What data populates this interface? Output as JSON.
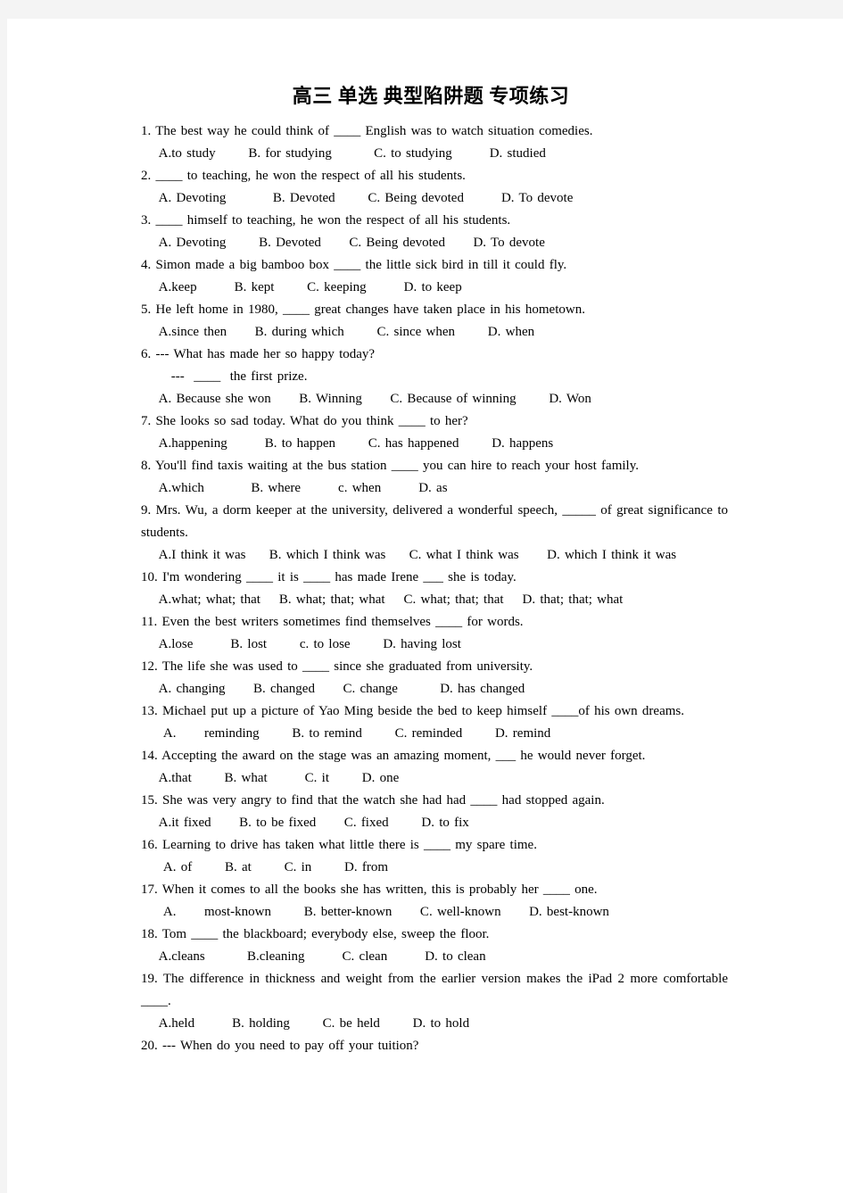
{
  "document": {
    "title": "高三 单选 典型陷阱题 专项练习"
  },
  "questions": [
    {
      "stem": "1. The best way he could think of ____ English was to watch situation comedies.",
      "options": "  A.to study       B. for studying         C. to studying        D. studied"
    },
    {
      "stem": "2. ____ to teaching, he won the respect of all his students.",
      "options": "  A. Devoting          B. Devoted       C. Being devoted        D. To devote"
    },
    {
      "stem": "3. ____ himself to teaching, he won the respect of all his students.",
      "options": "  A. Devoting       B. Devoted      C. Being devoted      D. To devote"
    },
    {
      "stem": "4. Simon made a big bamboo box ____ the little sick bird in till it could fly.",
      "options": "  A.keep        B. kept       C. keeping        D. to keep"
    },
    {
      "stem": "5. He left home in 1980, ____ great changes have taken place in his hometown.",
      "options": "  A.since then      B. during which       C. since when       D. when"
    },
    {
      "stem": "6. --- What has made her so happy today?",
      "dialog": "   ---  ____  the first prize.",
      "options": "  A. Because she won      B. Winning      C. Because of winning       D. Won"
    },
    {
      "stem": "7. She looks so sad today. What do you think ____ to her?",
      "options": "  A.happening        B. to happen       C. has happened       D. happens"
    },
    {
      "stem": "8. You'll find taxis waiting at the bus station ____ you can hire to reach your host family.",
      "options": "  A.which          B. where        c. when        D. as"
    },
    {
      "stem": "9. Mrs. Wu, a dorm keeper at the university, delivered a wonderful speech, _____ of great significance to students.",
      "options": "  A.I think it was     B. which I think was     C. what I think was      D. which I think it was"
    },
    {
      "stem": "10. I'm wondering ____ it is ____ has made Irene ___ she is today.",
      "options": "  A.what; what; that    B. what; that; what    C. what; that; that    D. that; that; what"
    },
    {
      "stem": "11. Even the best writers sometimes find themselves ____ for words.",
      "options": "  A.lose        B. lost       c. to lose       D. having lost"
    },
    {
      "stem": "12. The life she was used to ____ since she graduated from university.",
      "options": "  A. changing      B. changed      C. change         D. has changed"
    },
    {
      "stem": "13. Michael put up a picture of Yao Ming beside the bed to keep himself ____of his own dreams.",
      "options": "   A.      reminding       B. to remind       C. reminded       D. remind"
    },
    {
      "stem": "14. Accepting the award on the stage was an amazing moment, ___ he would never forget.",
      "options": "  A.that       B. what        C. it       D. one"
    },
    {
      "stem": "15. She was very angry to find that the watch she had had ____ had stopped again.",
      "options": "  A.it fixed      B. to be fixed      C. fixed       D. to fix"
    },
    {
      "stem": "16. Learning to drive has taken what little there is ____ my spare time.",
      "options": "   A. of       B. at       C. in       D. from"
    },
    {
      "stem": "17. When it comes to all the books she has written, this is probably her ____ one.",
      "options": "   A.      most-known       B. better-known      C. well-known      D. best-known"
    },
    {
      "stem": "18. Tom ____ the blackboard; everybody else, sweep the floor.",
      "options": "  A.cleans         B.cleaning        C. clean        D. to clean"
    },
    {
      "stem": "19. The difference in thickness and weight from the earlier version makes the iPad 2 more comfortable ____.",
      "options": "  A.held        B. holding       C. be held       D. to hold"
    },
    {
      "stem": "20. --- When do you need to pay off your tuition?",
      "options": null
    }
  ]
}
